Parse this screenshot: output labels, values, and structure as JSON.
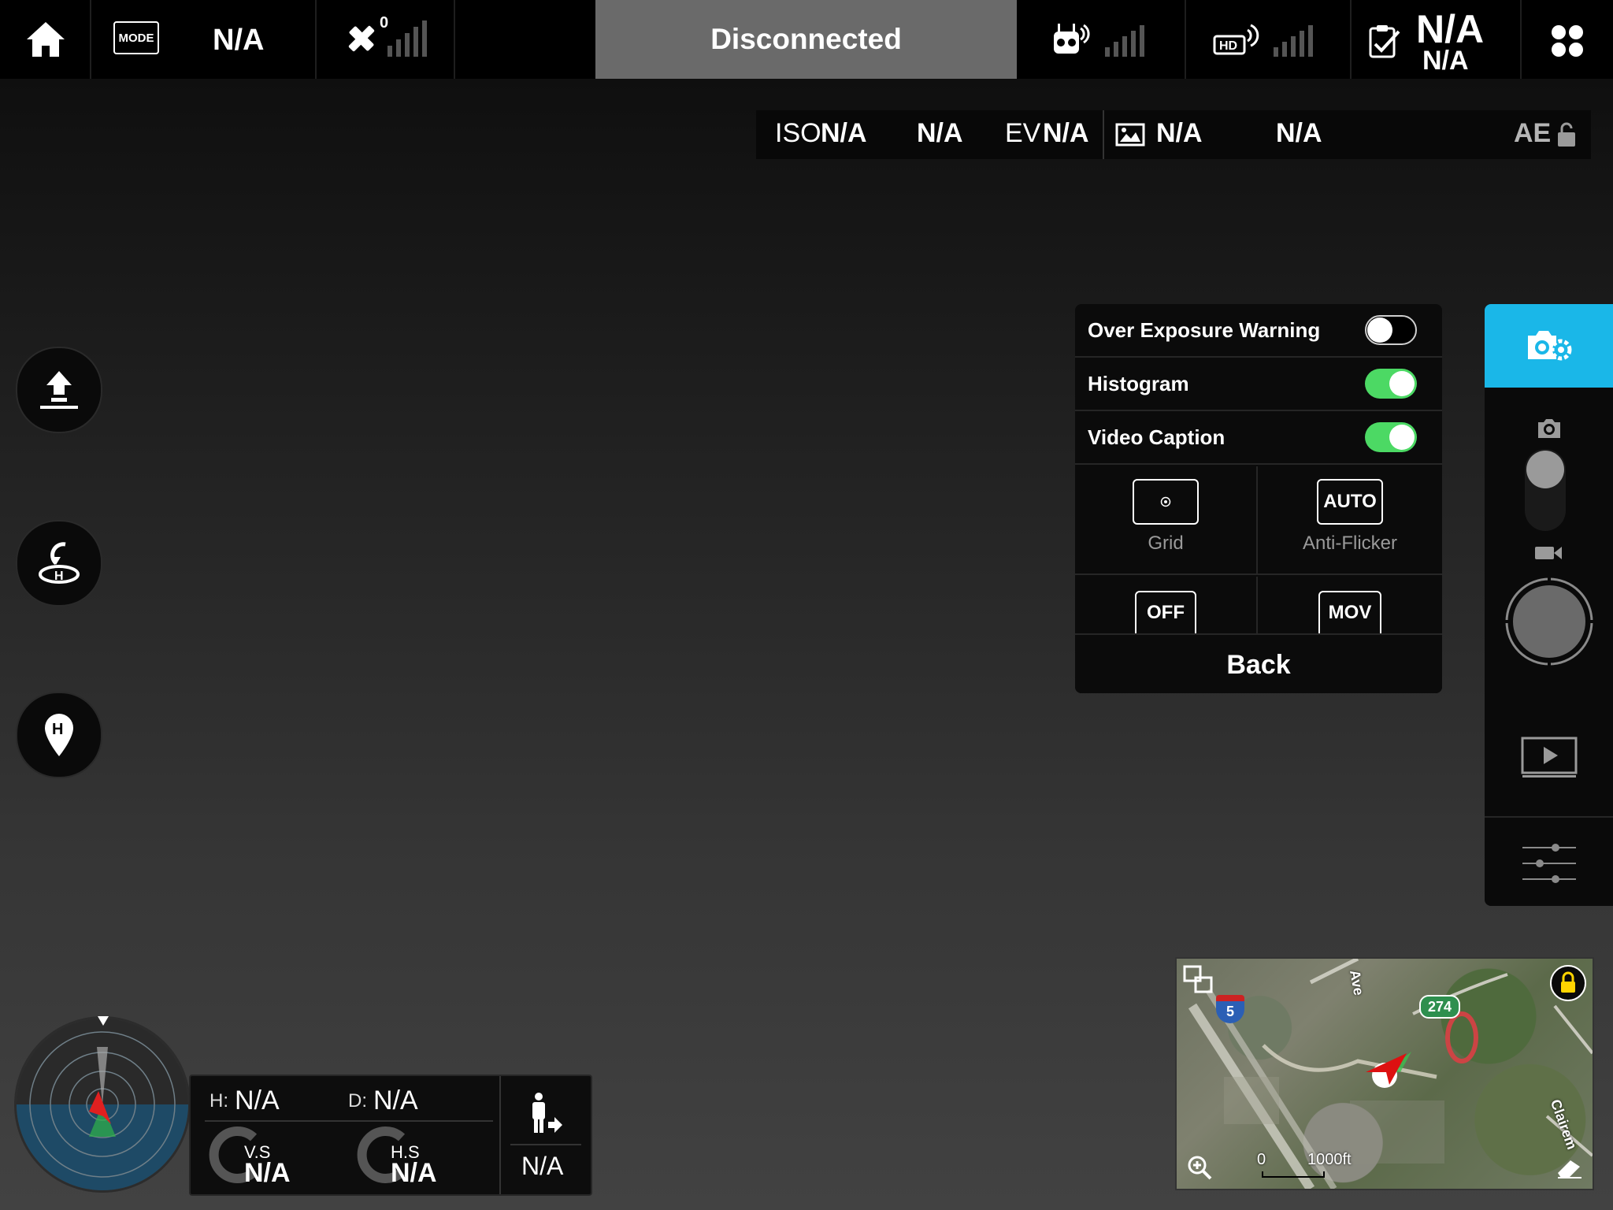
{
  "top_bar": {
    "mode_label": "MODE",
    "flight_mode": "N/A",
    "gps_count": "0",
    "connection_status": "Disconnected",
    "battery_top": "N/A",
    "battery_bottom": "N/A"
  },
  "camera_params": {
    "iso_label": "ISO",
    "iso_value": "N/A",
    "shutter_value": "N/A",
    "ev_label": "EV",
    "ev_value": "N/A",
    "format_value": "N/A",
    "wb_value": "N/A",
    "ae_label": "AE"
  },
  "settings_panel": {
    "rows": [
      {
        "label": "Over Exposure Warning",
        "enabled": false
      },
      {
        "label": "Histogram",
        "enabled": true
      },
      {
        "label": "Video Caption",
        "enabled": true
      }
    ],
    "grid_caption": "Grid",
    "antiflicker_value": "AUTO",
    "antiflicker_caption": "Anti-Flicker",
    "off_value": "OFF",
    "mov_value": "MOV",
    "back_label": "Back"
  },
  "telemetry": {
    "h_label": "H:",
    "h_value": "N/A",
    "d_label": "D:",
    "d_value": "N/A",
    "vs_label": "V.S",
    "vs_value": "N/A",
    "hs_label": "H.S",
    "hs_value": "N/A",
    "vps_value": "N/A"
  },
  "map": {
    "interstate": "5",
    "route": "274",
    "street_ave": "Ave",
    "street_clairemont": "Clairem",
    "scale_zero": "0",
    "scale_distance": "1000ft"
  },
  "colors": {
    "accent": "#1ab7e8",
    "toggle_on": "#4cd964",
    "status_bg": "#6a6a6a"
  }
}
